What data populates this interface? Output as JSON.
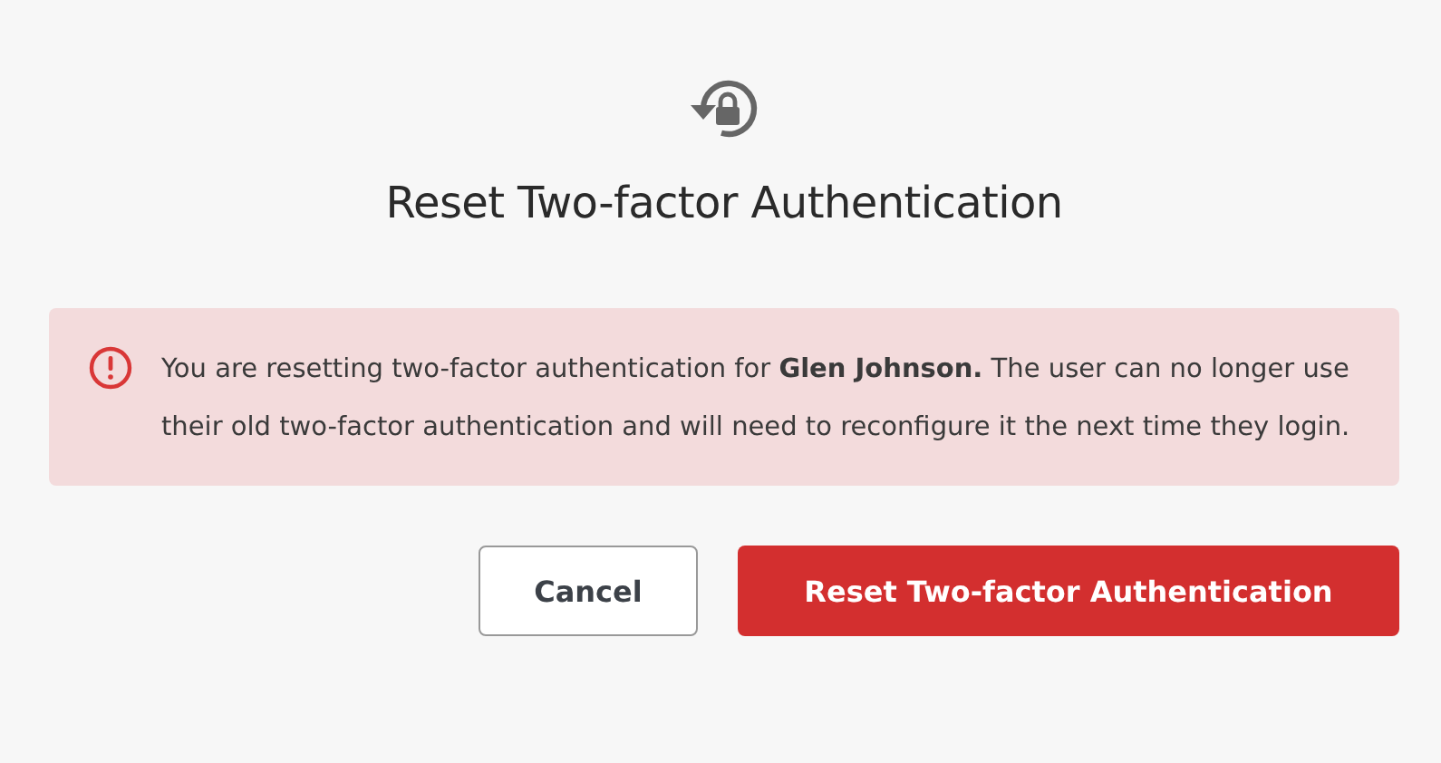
{
  "dialog": {
    "title": "Reset Two-factor Authentication"
  },
  "alert": {
    "message": "You are resetting two-factor authentication for **Glen Johnson.** The user can no longer use their old two-factor authentication and will need to reconfigure it the next time they login."
  },
  "buttons": [
    {
      "label": "Cancel",
      "kind": "secondary"
    },
    {
      "label": "Reset Two-factor Authentication",
      "kind": "danger"
    }
  ]
}
